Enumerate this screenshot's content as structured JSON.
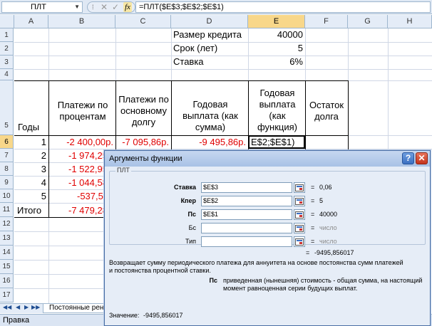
{
  "formula_bar": {
    "name_box": "ПЛТ",
    "cancel_glyph": "✕",
    "enter_glyph": "✓",
    "fx_glyph": "fx",
    "formula": "=ПЛТ($E$3;$E$2;$E$1)"
  },
  "columns": [
    "A",
    "B",
    "C",
    "D",
    "E",
    "F",
    "G",
    "H"
  ],
  "rows": [
    "1",
    "2",
    "3",
    "4",
    "5",
    "6",
    "7",
    "8",
    "9",
    "10",
    "11",
    "12",
    "13",
    "14",
    "15",
    "16",
    "17"
  ],
  "params": {
    "loan_label": "Размер кредита",
    "loan_value": "40000",
    "term_label": "Срок (лет)",
    "term_value": "5",
    "rate_label": "Ставка",
    "rate_value": "6%"
  },
  "table_headers": {
    "years": "Годы",
    "interest": "Платежи по процентам",
    "principal": "Платежи по основному долгу",
    "annual_sum": "Годовая выплата (как сумма)",
    "annual_func": "Годовая выплата (как функция)",
    "balance": "Остаток долга"
  },
  "table_rows": [
    {
      "year": "1",
      "interest": "-2 400,00р.",
      "principal": "-7 095,86р.",
      "annual": "-9 495,86р."
    },
    {
      "year": "2",
      "interest": "-1 974,25"
    },
    {
      "year": "3",
      "interest": "-1 522,95"
    },
    {
      "year": "4",
      "interest": "-1 044,58"
    },
    {
      "year": "5",
      "interest": "-537,50"
    }
  ],
  "total": {
    "label": "Итого",
    "interest": "-7 479,28"
  },
  "active_cell": "E$2;$E$1)",
  "sheet_tab": "Постоянные рент",
  "status_bar": "Правка",
  "dialog": {
    "title": "Аргументы функции",
    "help_glyph": "?",
    "close_glyph": "✕",
    "function_name": "ПЛТ",
    "args": [
      {
        "label": "Ставка",
        "value": "$E$3",
        "result": "0,06",
        "required": true
      },
      {
        "label": "Кпер",
        "value": "$E$2",
        "result": "5",
        "required": true
      },
      {
        "label": "Пс",
        "value": "$E$1",
        "result": "40000",
        "required": true
      },
      {
        "label": "Бс",
        "value": "",
        "result": "число",
        "required": false
      },
      {
        "label": "Тип",
        "value": "",
        "result": "число",
        "required": false
      }
    ],
    "equals": "=",
    "formula_result": "-9495,856017",
    "description": "Возвращает сумму периодического платежа для аннуитета на основе постоянства сумм платежей и постоянства процентной ставки.",
    "arg_name": "Пс",
    "arg_description": "приведенная (нынешняя) стоимость - общая сумма, на настоящий момент равноценная серии будущих выплат.",
    "value_label": "Значение:",
    "value": "-9495,856017"
  },
  "colors": {
    "negative_text": "#e00000",
    "header_bg": "#e4ecf7",
    "selected_header_bg": "#f8d78a",
    "dialog_bg": "#e6edf7"
  }
}
